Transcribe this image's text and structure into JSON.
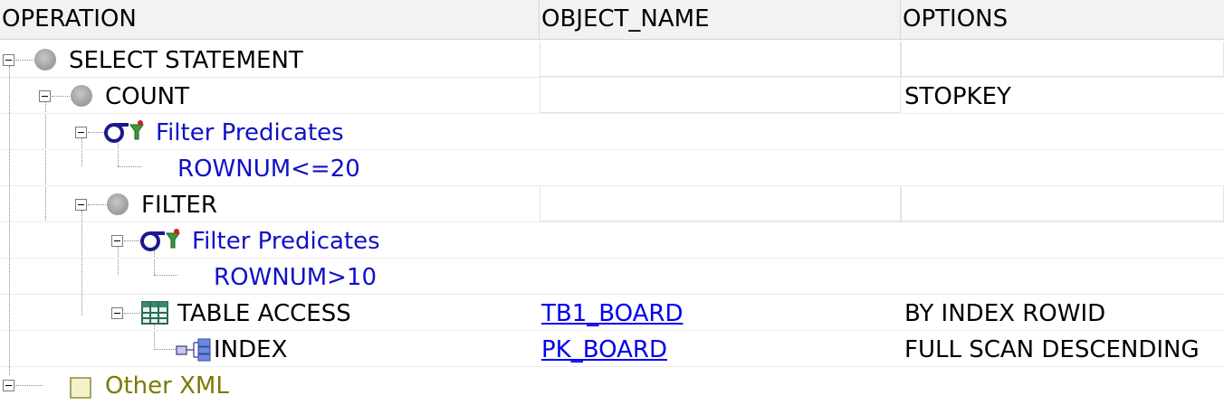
{
  "columns": {
    "operation": "OPERATION",
    "object_name": "OBJECT_NAME",
    "options": "OPTIONS"
  },
  "rows": [
    {
      "operation": "SELECT STATEMENT",
      "object_name": "",
      "options": "",
      "icon": "circle-icon"
    },
    {
      "operation": "COUNT",
      "object_name": "",
      "options": "STOPKEY",
      "icon": "circle-icon"
    },
    {
      "operation": "Filter Predicates",
      "icon": "filter-predicate-icon"
    },
    {
      "operation": "ROWNUM<=20"
    },
    {
      "operation": "FILTER",
      "object_name": "",
      "options": "",
      "icon": "circle-icon"
    },
    {
      "operation": "Filter Predicates",
      "icon": "filter-predicate-icon"
    },
    {
      "operation": "ROWNUM>10"
    },
    {
      "operation": "TABLE ACCESS",
      "object_name": "TB1_BOARD",
      "options": "BY INDEX ROWID",
      "icon": "table-icon"
    },
    {
      "operation": "INDEX",
      "object_name": "PK_BOARD",
      "options": "FULL SCAN DESCENDING",
      "icon": "index-icon"
    },
    {
      "operation": "Other XML",
      "icon": "xml-icon"
    }
  ],
  "colors": {
    "predicate_text": "#1010c8",
    "link_text": "#0000ee",
    "other_xml_text": "#7a7a00"
  }
}
